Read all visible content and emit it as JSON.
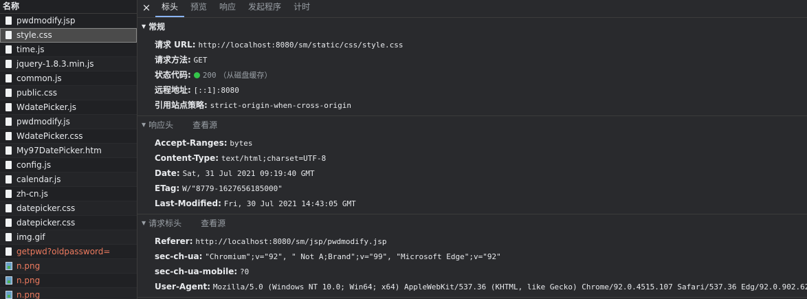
{
  "left": {
    "header": "名称",
    "files": [
      {
        "name": "pwdmodify.jsp",
        "kind": "doc",
        "failed": false
      },
      {
        "name": "style.css",
        "kind": "doc",
        "failed": false,
        "selected": true
      },
      {
        "name": "time.js",
        "kind": "doc",
        "failed": false
      },
      {
        "name": "jquery-1.8.3.min.js",
        "kind": "doc",
        "failed": false
      },
      {
        "name": "common.js",
        "kind": "doc",
        "failed": false
      },
      {
        "name": "public.css",
        "kind": "doc",
        "failed": false
      },
      {
        "name": "WdatePicker.js",
        "kind": "doc",
        "failed": false
      },
      {
        "name": "pwdmodify.js",
        "kind": "doc",
        "failed": false
      },
      {
        "name": "WdatePicker.css",
        "kind": "doc",
        "failed": false
      },
      {
        "name": "My97DatePicker.htm",
        "kind": "doc",
        "failed": false
      },
      {
        "name": "config.js",
        "kind": "doc",
        "failed": false
      },
      {
        "name": "calendar.js",
        "kind": "doc",
        "failed": false
      },
      {
        "name": "zh-cn.js",
        "kind": "doc",
        "failed": false
      },
      {
        "name": "datepicker.css",
        "kind": "doc",
        "failed": false
      },
      {
        "name": "datepicker.css",
        "kind": "doc",
        "failed": false
      },
      {
        "name": "img.gif",
        "kind": "doc",
        "failed": false
      },
      {
        "name": "getpwd?oldpassword=",
        "kind": "doc",
        "failed": true
      },
      {
        "name": "n.png",
        "kind": "image",
        "failed": true
      },
      {
        "name": "n.png",
        "kind": "image",
        "failed": true
      },
      {
        "name": "n.png",
        "kind": "image",
        "failed": true
      }
    ]
  },
  "tabs": {
    "close": "×",
    "headers": "标头",
    "preview": "预览",
    "response": "响应",
    "initiator": "发起程序",
    "timing": "计时"
  },
  "general": {
    "title": "常规",
    "url_label": "请求 URL:",
    "url_value": "http://localhost:8080/sm/static/css/style.css",
    "method_label": "请求方法:",
    "method_value": "GET",
    "status_label": "状态代码:",
    "status_code": "200",
    "status_note": "（从磁盘缓存）",
    "remote_label": "远程地址:",
    "remote_value": "[::1]:8080",
    "referrer_policy_label": "引用站点策略:",
    "referrer_policy_value": "strict-origin-when-cross-origin",
    "status_color": "#34c44a"
  },
  "response_headers": {
    "title": "响应头",
    "view_source": "查看源",
    "rows": [
      {
        "k": "Accept-Ranges:",
        "v": "bytes"
      },
      {
        "k": "Content-Type:",
        "v": "text/html;charset=UTF-8"
      },
      {
        "k": "Date:",
        "v": "Sat, 31 Jul 2021 09:19:40 GMT"
      },
      {
        "k": "ETag:",
        "v": "W/\"8779-1627656185000\""
      },
      {
        "k": "Last-Modified:",
        "v": "Fri, 30 Jul 2021 14:43:05 GMT"
      }
    ]
  },
  "request_headers": {
    "title": "请求标头",
    "view_source": "查看源",
    "rows": [
      {
        "k": "Referer:",
        "v": "http://localhost:8080/sm/jsp/pwdmodify.jsp"
      },
      {
        "k": "sec-ch-ua:",
        "v": "\"Chromium\";v=\"92\", \" Not A;Brand\";v=\"99\", \"Microsoft Edge\";v=\"92\""
      },
      {
        "k": "sec-ch-ua-mobile:",
        "v": "?0"
      },
      {
        "k": "User-Agent:",
        "v": "Mozilla/5.0 (Windows NT 10.0; Win64; x64) AppleWebKit/537.36 (KHTML, like Gecko) Chrome/92.0.4515.107 Safari/537.36 Edg/92.0.902.62"
      }
    ]
  }
}
